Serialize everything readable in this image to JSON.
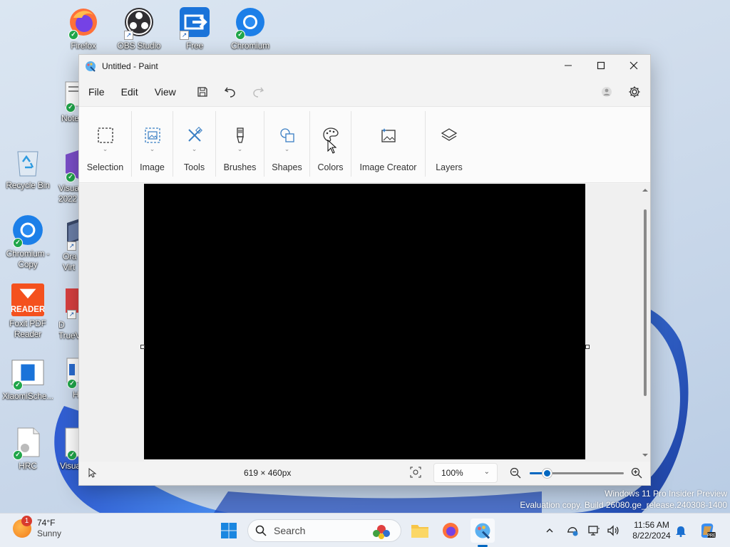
{
  "desktop": {
    "icons": [
      {
        "name": "desktop-icon-firefox",
        "label": "Firefox"
      },
      {
        "name": "desktop-icon-obs",
        "label": "OBS Studio"
      },
      {
        "name": "desktop-icon-free",
        "label": "Free"
      },
      {
        "name": "desktop-icon-chromium",
        "label": "Chromium"
      },
      {
        "name": "desktop-icon-notepad",
        "label": "Note"
      },
      {
        "name": "desktop-icon-recycle-bin",
        "label": "Recycle Bin"
      },
      {
        "name": "desktop-icon-visual-studio",
        "label": "Visua 2022"
      },
      {
        "name": "desktop-icon-chromium-copy",
        "label": "Chromium - Copy"
      },
      {
        "name": "desktop-icon-oracle-virtualbox",
        "label": "Ora Virt"
      },
      {
        "name": "desktop-icon-foxit-reader",
        "label": "Foxit PDF Reader"
      },
      {
        "name": "desktop-icon-truevision",
        "label": "D TrueV"
      },
      {
        "name": "desktop-icon-xiaomi",
        "label": "XiaomiSche..."
      },
      {
        "name": "desktop-icon-h",
        "label": "H"
      },
      {
        "name": "desktop-icon-hrc",
        "label": "HRC"
      },
      {
        "name": "desktop-icon-visual",
        "label": "Visua"
      }
    ]
  },
  "window": {
    "title": "Untitled - Paint",
    "minimize": "—",
    "maximize": "☐",
    "close": "✕"
  },
  "menu": {
    "file": "File",
    "edit": "Edit",
    "view": "View"
  },
  "ribbon": {
    "groups": [
      {
        "label": "Selection"
      },
      {
        "label": "Image"
      },
      {
        "label": "Tools"
      },
      {
        "label": "Brushes"
      },
      {
        "label": "Shapes"
      },
      {
        "label": "Colors"
      },
      {
        "label": "Image Creator"
      },
      {
        "label": "Layers"
      }
    ]
  },
  "status": {
    "canvas_size": "619 × 460px",
    "zoom": "100%",
    "zoom_slider_fraction": 0.18
  },
  "watermark": {
    "line1": "Windows 11 Pro Insider Preview",
    "line2": "Evaluation copy. Build 26080.ge_release.240308-1400"
  },
  "taskbar": {
    "weather": {
      "badge": "1",
      "temp": "74°F",
      "condition": "Sunny"
    },
    "search_placeholder": "Search",
    "time": "11:56 AM",
    "date": "8/22/2024"
  },
  "colors": {
    "accent": "#0067c0",
    "canvas": "#000000"
  }
}
